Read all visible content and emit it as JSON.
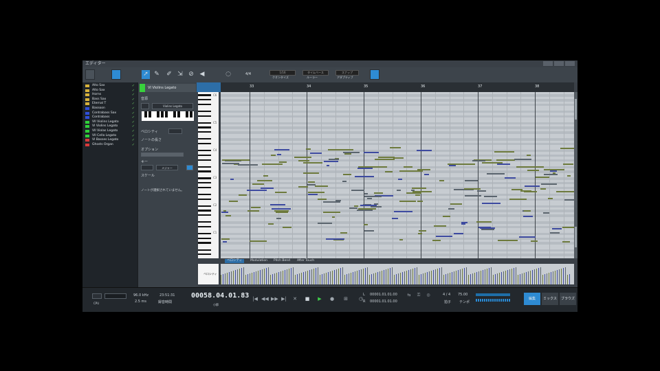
{
  "window": {
    "title": "エディター"
  },
  "toolbar": {
    "zoom_label": "4/4",
    "quantize_label": "1/16",
    "timebase_label": "タイムベース",
    "snap_label": "スナップ",
    "quantize_sub": "クオンタイズ",
    "timebase_sub": "ルーラー",
    "snap_sub": "アダプティブ"
  },
  "tracks": [
    {
      "name": "Alto Sax",
      "color": "#d8b23a"
    },
    {
      "name": "Alto Sax",
      "color": "#d8b23a"
    },
    {
      "name": "Horns",
      "color": "#d8b23a"
    },
    {
      "name": "Bass Sax",
      "color": "#d8b23a"
    },
    {
      "name": "Eternal T",
      "color": "#d8b23a"
    },
    {
      "name": "Bassoon",
      "color": "#2f4fd8"
    },
    {
      "name": "Contrabass Sax",
      "color": "#2f4fd8"
    },
    {
      "name": "Contrabass",
      "color": "#2f4fd8"
    },
    {
      "name": "VII Violins Legato",
      "color": "#2fd039"
    },
    {
      "name": "VI Violins Legato",
      "color": "#2fd039"
    },
    {
      "name": "VII Violas Legato",
      "color": "#2fd039"
    },
    {
      "name": "VII Cello Legato",
      "color": "#2fd039"
    },
    {
      "name": "VI Basses Legato",
      "color": "#d83a3a"
    },
    {
      "name": "Ghosts Organ",
      "color": "#d83a3a"
    }
  ],
  "inspector": {
    "track_name": "VI Violins Legato",
    "section_label": "音源",
    "preset_value": "Violins Legato",
    "velocity_label": "ベロシティ",
    "length_label": "ノートの長さ",
    "option_label": "オプション",
    "key_label": "キー",
    "scale_label": "スケール",
    "scale_value": "メジャー",
    "status_text": "ノートが選択されていません。"
  },
  "ruler": {
    "bars": [
      "33",
      "34",
      "35",
      "36",
      "37",
      "38"
    ]
  },
  "piano": {
    "octaves": [
      "C6",
      "C5",
      "C4",
      "C3",
      "C2",
      "C1"
    ]
  },
  "controller_tabs": [
    "ベロシティ",
    "Modulation",
    "Pitch Bend",
    "After Touch"
  ],
  "velocity_panel": {
    "label": "ベロシティ"
  },
  "transport": {
    "cpu_label": "CPU",
    "sample_rate": "96.0 kHz",
    "latency": "2.5 ms",
    "record_time": "23:51:31",
    "record_label": "録音時間",
    "position": "00058.04.01.83",
    "position_unit": "小節",
    "loop_start": "00001.01.01.00",
    "loop_end": "00001.01.01.00",
    "loop_start_label": "L",
    "loop_end_label": "R",
    "signature": "4 / 4",
    "signature_label": "拍子",
    "tempo": "75.00",
    "tempo_label": "テンポ",
    "edit_tab": "編集",
    "mix_tab": "ミックス",
    "browse_tab": "ブラウズ"
  },
  "colors": {
    "accent": "#2e8bd3",
    "note_olive": "#6d7a3c",
    "note_blue": "#3d4aa0",
    "note_gray": "#5a646d"
  },
  "icons": [
    "arrow-tool-icon",
    "pencil-tool-icon",
    "eraser-tool-icon",
    "range-tool-icon",
    "mute-tool-icon",
    "listen-tool-icon",
    "loop-icon",
    "play-icon",
    "stop-icon",
    "record-icon",
    "metronome-icon"
  ]
}
